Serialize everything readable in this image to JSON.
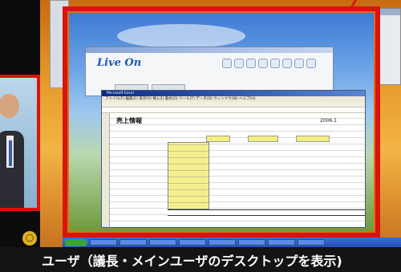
{
  "caption": {
    "text": "ユーザ（議長・メインユーザのデスクトップを表示)"
  },
  "liveon": {
    "logo_text": "Live On",
    "tabs": [
      "",
      ""
    ]
  },
  "excel": {
    "title_bar": "Microsoft Excel",
    "menu": "ファイル(F)  編集(E)  表示(V)  挿入(I)  書式(O)  ツール(T)  データ(D)  ウィンドウ(W)  ヘルプ(H)",
    "sheet_title": "売上情報",
    "sheet_date": "2006.1"
  },
  "colors": {
    "highlight_frame": "#d8140c",
    "cell_highlight": "#f4ef8c"
  }
}
